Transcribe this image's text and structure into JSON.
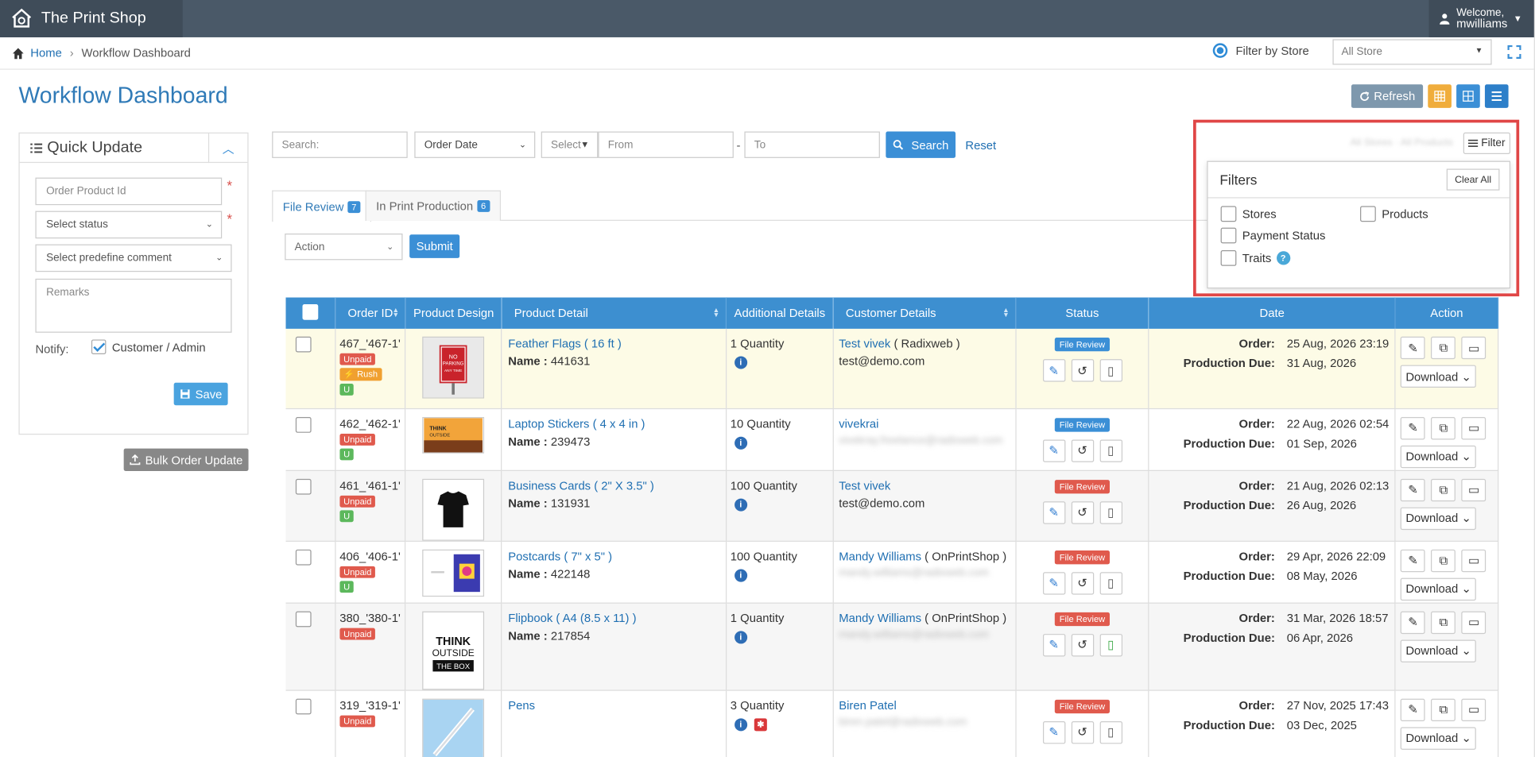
{
  "app": {
    "name": "The Print Shop"
  },
  "user": {
    "welcome": "Welcome,",
    "username": "mwilliams"
  },
  "breadcrumb": {
    "home": "Home",
    "current": "Workflow Dashboard"
  },
  "store_filter": {
    "label": "Filter by Store",
    "value": "All Store"
  },
  "page": {
    "title": "Workflow Dashboard",
    "refresh_label": "Refresh"
  },
  "quick_update": {
    "title": "Quick Update",
    "order_product_id_placeholder": "Order Product Id",
    "status_placeholder": "Select status",
    "comment_placeholder": "Select predefine comment",
    "remarks_placeholder": "Remarks",
    "notify_label": "Notify:",
    "notify_option": "Customer / Admin",
    "save_label": "Save",
    "bulk_label": "Bulk Order Update"
  },
  "search": {
    "placeholder": "Search:",
    "date_type": "Order Date",
    "select_label": "Select",
    "from_placeholder": "From",
    "to_placeholder": "To",
    "search_label": "Search",
    "reset_label": "Reset"
  },
  "tabs": [
    {
      "label": "File Review",
      "count": "7"
    },
    {
      "label": "In Print Production",
      "count": "6"
    }
  ],
  "bulk_action": {
    "placeholder": "Action",
    "submit_label": "Submit"
  },
  "filters": {
    "button_label": "Filter",
    "title": "Filters",
    "clear_label": "Clear All",
    "options": [
      "Stores",
      "Products",
      "Payment Status",
      "Traits"
    ],
    "help_icon_text": "?"
  },
  "table": {
    "columns": [
      "Order ID",
      "Product Design",
      "Product Detail",
      "Additional Details",
      "Customer Details",
      "Status",
      "Date",
      "Action"
    ],
    "order_label": "Order:",
    "due_label": "Production Due:",
    "name_label": "Name :",
    "download_label": "Download",
    "rows": [
      {
        "id": "467_'467-1'",
        "payment": "Unpaid",
        "rush": "Rush",
        "u": "U",
        "product": "Feather Flags ( 16 ft )",
        "name": "441631",
        "qty": "1 Quantity",
        "customer": "Test vivek",
        "company": "( Radixweb )",
        "email": "test@demo.com",
        "status": "File Review",
        "order_date": "25 Aug, 2026 23:19",
        "due_date": "31 Aug, 2026"
      },
      {
        "id": "462_'462-1'",
        "payment": "Unpaid",
        "u": "U",
        "product": "Laptop Stickers ( 4 x 4 in )",
        "name": "239473",
        "qty": "10 Quantity",
        "customer": "vivekrai",
        "email": "vivekray.freelance@radixweb.com",
        "status": "File Review",
        "order_date": "22 Aug, 2026 02:54",
        "due_date": "01 Sep, 2026"
      },
      {
        "id": "461_'461-1'",
        "payment": "Unpaid",
        "u": "U",
        "product": "Business Cards ( 2\" X 3.5\" )",
        "name": "131931",
        "qty": "100 Quantity",
        "customer": "Test vivek",
        "email": "test@demo.com",
        "status": "File Review",
        "order_date": "21 Aug, 2026 02:13",
        "due_date": "26 Aug, 2026"
      },
      {
        "id": "406_'406-1'",
        "payment": "Unpaid",
        "u": "U",
        "product": "Postcards ( 7\" x 5\" )",
        "name": "422148",
        "qty": "100 Quantity",
        "customer": "Mandy Williams",
        "company": "( OnPrintShop )",
        "email": "mandy.williams@radixweb.com",
        "status": "File Review",
        "order_date": "29 Apr, 2026 22:09",
        "due_date": "08 May, 2026"
      },
      {
        "id": "380_'380-1'",
        "payment": "Unpaid",
        "product": "Flipbook ( A4 (8.5 x 11) )",
        "name": "217854",
        "qty": "1 Quantity",
        "customer": "Mandy Williams",
        "company": "( OnPrintShop )",
        "email": "mandy.williams@radixweb.com",
        "status": "File Review",
        "order_date": "31 Mar, 2026 18:57",
        "due_date": "06 Apr, 2026"
      },
      {
        "id": "319_'319-1'",
        "payment": "Unpaid",
        "product": "Pens",
        "qty": "3 Quantity",
        "customer": "Biren Patel",
        "email": "biren.patel@radixweb.com",
        "status": "File Review",
        "order_date": "27 Nov, 2025 17:43",
        "due_date": "03 Dec, 2025"
      }
    ]
  },
  "images": {
    "row1_sign_text": "NO PARKING ANY TIME TOW AWAY ZONE",
    "row2_sticker_text": "THINK OUTSIDE THE BOX",
    "row5_flip_text": "THINK OUTSIDE THE BOX"
  },
  "colors": {
    "header": "#4a5968",
    "accent": "#3d8fd0",
    "highlight": "#e04646"
  }
}
